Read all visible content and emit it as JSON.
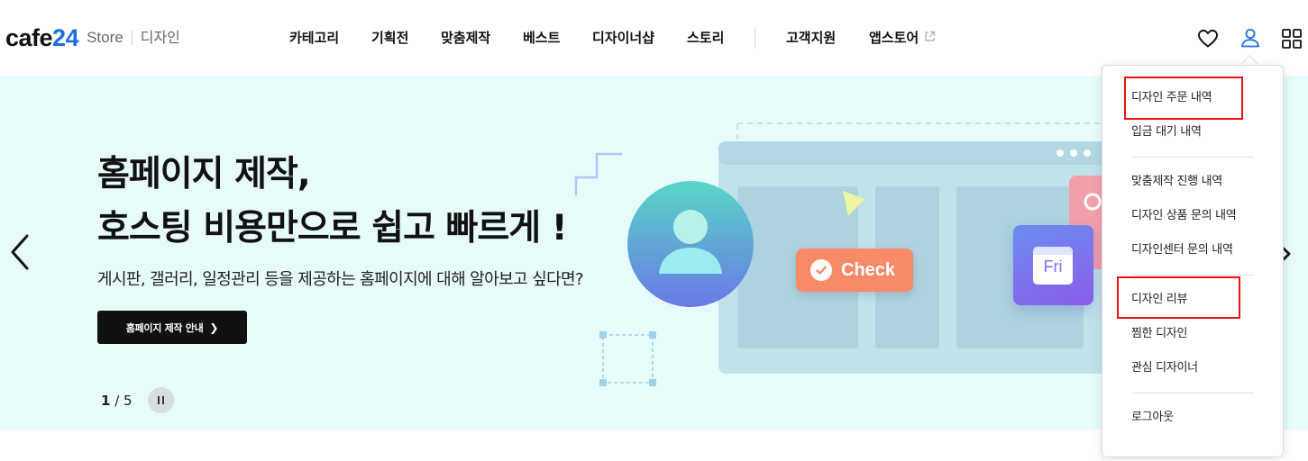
{
  "header": {
    "logo_text": "cafe",
    "logo_number": "24",
    "logo_store": "Store",
    "logo_section": "디자인",
    "nav": [
      {
        "label": "카테고리"
      },
      {
        "label": "기획전"
      },
      {
        "label": "맞춤제작"
      },
      {
        "label": "베스트"
      },
      {
        "label": "디자이너샵"
      },
      {
        "label": "스토리"
      }
    ],
    "nav_secondary": [
      {
        "label": "고객지원"
      },
      {
        "label": "앱스토어"
      }
    ],
    "icons": [
      "heart-icon",
      "user-icon",
      "grid-menu-icon"
    ],
    "accent_color": "#1a6fe0"
  },
  "hero": {
    "title_line1": "홈페이지 제작,",
    "title_line2": "호스팅 비용만으로 쉽고 빠르게 !",
    "subtitle": "게시판, 갤러리, 일정관리 등을 제공하는 홈페이지에 대해 알아보고 싶다면?",
    "button_label": "홈페이지 제작 안내",
    "pager_current": "1",
    "pager_total": "/ 5",
    "check_label": "Check",
    "calendar_label": "Fri",
    "background_color": "#e7fbfb"
  },
  "user_menu": {
    "items": [
      {
        "label": "디자인 주문 내역",
        "highlighted": true
      },
      {
        "label": "입금 대기 내역"
      },
      {
        "label": "맞춤제작 진행 내역"
      },
      {
        "label": "디자인 상품 문의 내역"
      },
      {
        "label": "디자인센터 문의 내역"
      },
      {
        "label": "디자인 리뷰",
        "highlighted": true
      },
      {
        "label": "찜한 디자인"
      },
      {
        "label": "관심 디자이너"
      },
      {
        "label": "로그아웃"
      }
    ],
    "highlight_color": "#ee1111"
  }
}
